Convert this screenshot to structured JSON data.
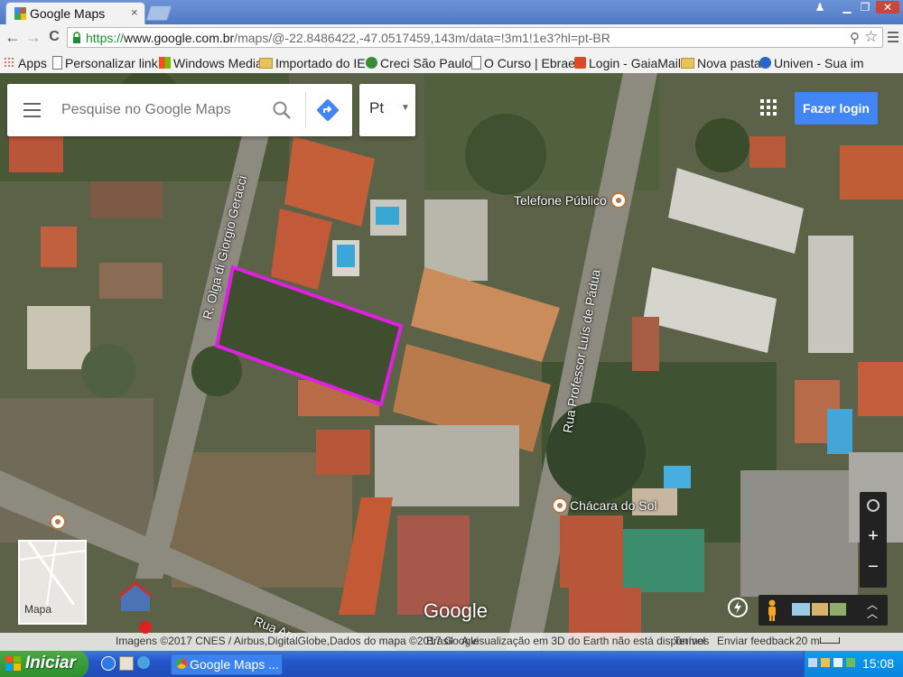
{
  "browser": {
    "tab_title": "Google Maps",
    "tab_close": "×",
    "nav_back": "←",
    "nav_forward": "→",
    "nav_reload": "C",
    "url_scheme": "https://",
    "url_host": "www.google.com.br",
    "url_rest": "/maps/@-22.8486422,-47.0517459,143m/data=!3m1!1e3?hl=pt-BR",
    "bookmarks": [
      {
        "label": "Apps",
        "icon": "apps-grid-icon"
      },
      {
        "label": "Personalizar link",
        "icon": "page-icon"
      },
      {
        "label": "Windows Media",
        "icon": "windows-icon"
      },
      {
        "label": "Importado do IE",
        "icon": "folder-icon"
      },
      {
        "label": "Creci São Paulo",
        "icon": "globe-icon"
      },
      {
        "label": "O Curso | Ebrae",
        "icon": "page-icon"
      },
      {
        "label": "Login - GaiaMail",
        "icon": "gaiamail-icon"
      },
      {
        "label": "Nova pasta",
        "icon": "folder-icon"
      },
      {
        "label": "Univen - Sua im",
        "icon": "univen-icon"
      }
    ]
  },
  "maps": {
    "search_placeholder": "Pesquise no Google Maps",
    "language_value": "Pt",
    "login_label": "Fazer login",
    "poi": {
      "telefone": "Telefone Público",
      "chacara": "Chácara do Sol"
    },
    "streets": {
      "olga": "R. Olga di Giorgio Geracci",
      "professor": "Rua Professor Luís de Pádua",
      "arquiteto": "Rua Arquite"
    },
    "watermark": "Google",
    "minimap_label": "Mapa",
    "zoom_in": "+",
    "zoom_out": "−",
    "footer": {
      "imagery": "Imagens ©2017 CNES / Airbus,DigitalGlobe,Dados do mapa ©2017 Google",
      "country": "Brasil",
      "earth_notice": "A visualização em 3D do Earth não está disponível",
      "terms": "Termos",
      "feedback": "Enviar feedback",
      "scale": "20 m"
    },
    "highlight_color": "#e020e0"
  },
  "taskbar": {
    "start_label": "Iniciar",
    "task_label": "Google Maps ...",
    "clock": "15:08"
  }
}
